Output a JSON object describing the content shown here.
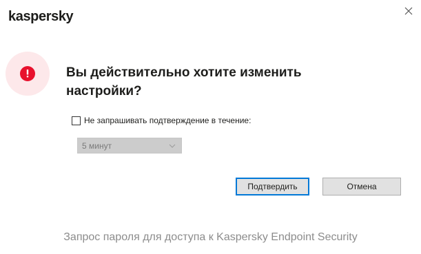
{
  "app": {
    "logo_text": "kaspersky"
  },
  "dialog": {
    "question": "Вы действительно хотите изменить настройки?",
    "checkbox_label": "Не запрашивать подтверждение в течение:",
    "checkbox_checked": false,
    "duration_select": {
      "selected": "5 минут",
      "enabled": false
    },
    "confirm_label": "Подтвердить",
    "cancel_label": "Отмена",
    "footer_text": "Запрос пароля для доступа к Kaspersky Endpoint Security"
  },
  "icons": {
    "close": "close-icon",
    "warning": "exclamation-icon",
    "dropdown": "chevron-down-icon"
  },
  "colors": {
    "warning_red": "#e8112d",
    "warning_bg": "#fde8ea",
    "focus_blue": "#0078d7",
    "footer_gray": "#8c8c8c"
  }
}
